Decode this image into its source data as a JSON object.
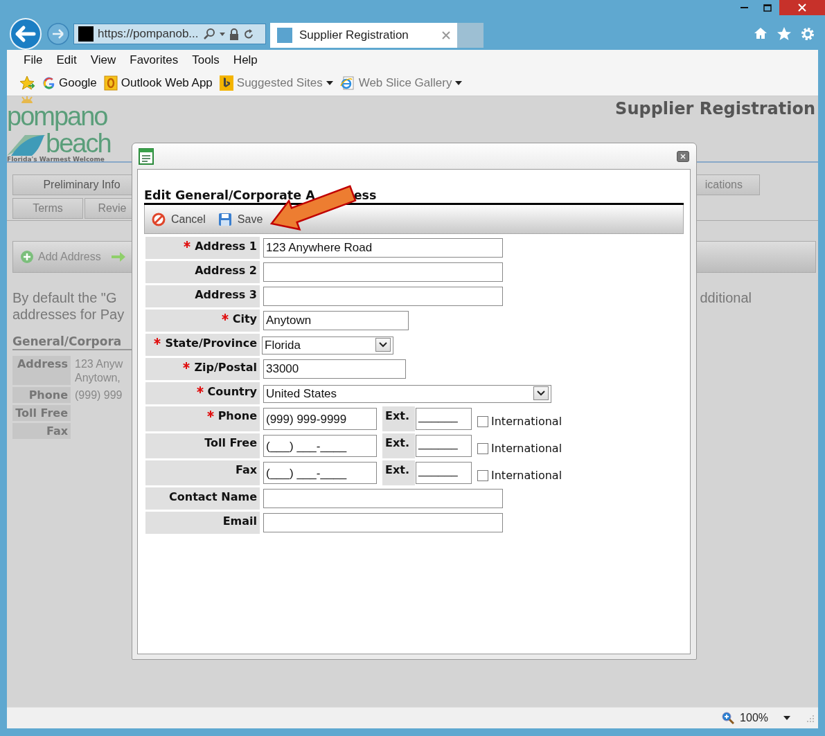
{
  "browser": {
    "url": "https://pompanob...",
    "tabs": [
      {
        "title": "Supplier Registration",
        "selected": true
      }
    ],
    "menu": [
      "File",
      "Edit",
      "View",
      "Favorites",
      "Tools",
      "Help"
    ],
    "favorites": [
      {
        "label": "Google",
        "kind": "google",
        "dropdown": false
      },
      {
        "label": "Outlook Web App",
        "kind": "outlook",
        "dropdown": false
      },
      {
        "label": "Suggested Sites",
        "kind": "bing",
        "dropdown": true
      },
      {
        "label": "Web Slice Gallery",
        "kind": "ie",
        "dropdown": true
      }
    ]
  },
  "page": {
    "logo": {
      "line1": "pompano",
      "line2": "beach",
      "tagline": "Florida's Warmest Welcome"
    },
    "title": "Supplier Registration",
    "step_tabs_left": [
      [
        {
          "label": "Preliminary Info",
          "disabled": false
        }
      ],
      [
        {
          "label": "Terms",
          "disabled": true
        },
        {
          "label": "Revie",
          "disabled": true
        }
      ]
    ],
    "step_tabs_right": [
      {
        "label": "ications",
        "disabled": true
      }
    ],
    "toolbar": {
      "add_label": "Add Address"
    },
    "intro": {
      "left_lines": [
        "By default the \"G",
        "addresses for Pay"
      ],
      "right_line": "dditional"
    },
    "section_heading": "General/Corpora",
    "details": [
      {
        "label": "Address",
        "lines": [
          "123 Anyw",
          "Anytown,"
        ]
      },
      {
        "label": "Phone",
        "lines": [
          "(999) 999"
        ]
      },
      {
        "label": "Toll Free"
      },
      {
        "label": "Fax"
      }
    ]
  },
  "dialog": {
    "heading": [
      "Edit General/Corporate A",
      "ess"
    ],
    "actions": [
      {
        "label": "Cancel",
        "kind": "cancel"
      },
      {
        "label": "Save",
        "kind": "save"
      }
    ],
    "fields": [
      {
        "kind": "text",
        "label": "Address 1",
        "required": true,
        "value": "123 Anywhere Road"
      },
      {
        "kind": "text",
        "label": "Address 2",
        "required": false
      },
      {
        "kind": "text",
        "label": "Address 3",
        "required": false
      },
      {
        "kind": "text",
        "label": "City",
        "required": true,
        "value": "Anytown"
      },
      {
        "kind": "select",
        "label": "State/Province",
        "required": true,
        "value": "Florida"
      },
      {
        "kind": "text",
        "label": "Zip/Postal",
        "required": true,
        "value": "33000"
      },
      {
        "kind": "select",
        "label": "Country",
        "required": true,
        "value": "United States"
      },
      {
        "kind": "phone",
        "label": "Phone",
        "required": true,
        "value": "(999) 999-9999",
        "ext_label": "Ext.",
        "ext_value": "______",
        "international": {
          "label": "International",
          "checked": false
        }
      },
      {
        "kind": "phone",
        "label": "Toll Free",
        "required": false,
        "value": "(___) ___-____",
        "ext_label": "Ext.",
        "ext_value": "______",
        "international": {
          "label": "International",
          "checked": false
        }
      },
      {
        "kind": "phone",
        "label": "Fax",
        "required": false,
        "value": "(___) ___-____",
        "ext_label": "Ext.",
        "ext_value": "______",
        "international": {
          "label": "International",
          "checked": false
        }
      },
      {
        "kind": "text",
        "label": "Contact Name",
        "required": false
      },
      {
        "kind": "text",
        "label": "Email",
        "required": false
      }
    ]
  },
  "status_bar": {
    "zoom": "100%"
  }
}
